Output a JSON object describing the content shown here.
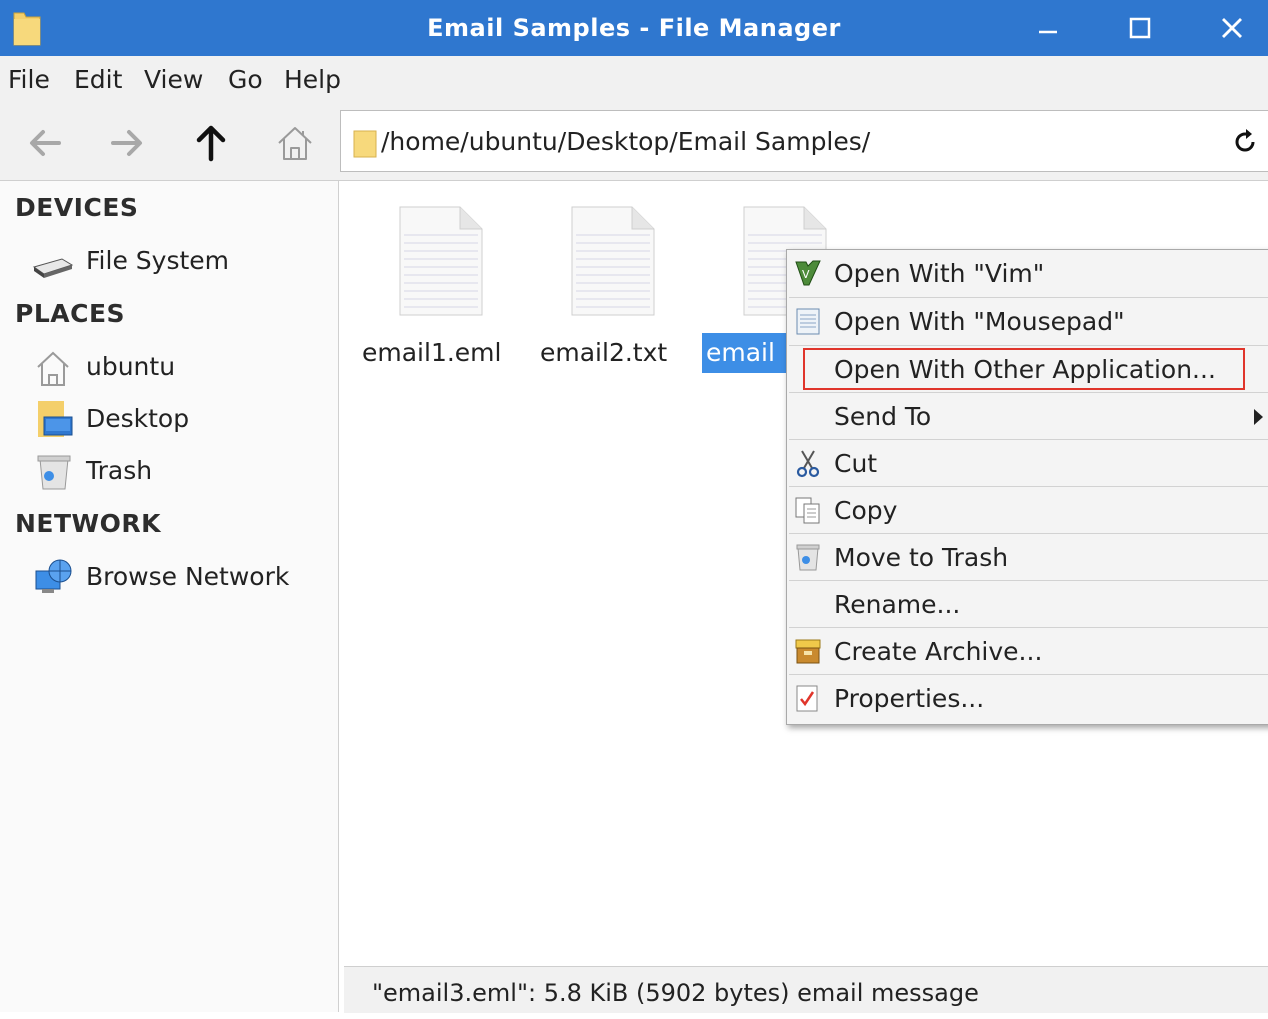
{
  "window": {
    "title": "Email Samples - File Manager",
    "icons": {
      "app": "folder-icon",
      "minimize": "minimize-icon",
      "maximize": "maximize-icon",
      "close": "close-icon"
    },
    "title_bar_color": "#2f77cf"
  },
  "menu": {
    "items": [
      "File",
      "Edit",
      "View",
      "Go",
      "Help"
    ]
  },
  "toolbar": {
    "back_icon": "arrow-left-icon",
    "forward_icon": "arrow-right-icon",
    "up_icon": "arrow-up-icon",
    "home_icon": "home-icon",
    "location": "/home/ubuntu/Desktop/Email Samples/",
    "reload_icon": "reload-icon"
  },
  "sidebar": {
    "sections": [
      {
        "title": "DEVICES",
        "items": [
          {
            "label": "File System",
            "icon": "drive-icon"
          }
        ]
      },
      {
        "title": "PLACES",
        "items": [
          {
            "label": "ubuntu",
            "icon": "home-folder-icon"
          },
          {
            "label": "Desktop",
            "icon": "desktop-folder-icon"
          },
          {
            "label": "Trash",
            "icon": "trash-icon"
          }
        ]
      },
      {
        "title": "NETWORK",
        "items": [
          {
            "label": "Browse Network",
            "icon": "network-icon"
          }
        ]
      }
    ]
  },
  "files": [
    {
      "name": "email1.eml",
      "selected": false,
      "icon": "text-document-icon"
    },
    {
      "name": "email2.txt",
      "selected": false,
      "icon": "text-document-icon"
    },
    {
      "name": "email3.eml",
      "visible_name": "email",
      "selected": true,
      "icon": "text-document-icon"
    }
  ],
  "selection_color": "#3d8ee6",
  "context_menu": {
    "items": [
      {
        "label": "Open With \"Vim\"",
        "icon": "vim-icon"
      },
      {
        "label": "Open With \"Mousepad\"",
        "icon": "mousepad-icon"
      },
      {
        "label": "Open With Other Application...",
        "icon": "",
        "highlighted": true
      },
      {
        "label": "Send To",
        "icon": "",
        "submenu": true
      },
      {
        "label": "Cut",
        "icon": "scissors-icon"
      },
      {
        "label": "Copy",
        "icon": "copy-icon"
      },
      {
        "label": "Move to Trash",
        "icon": "trash-icon"
      },
      {
        "label": "Rename...",
        "icon": ""
      },
      {
        "label": "Create Archive...",
        "icon": "archive-icon"
      },
      {
        "label": "Properties...",
        "icon": "properties-icon"
      }
    ],
    "highlight_color": "#e0352b"
  },
  "status": {
    "text": "\"email3.eml\": 5.8 KiB (5902 bytes) email message"
  }
}
